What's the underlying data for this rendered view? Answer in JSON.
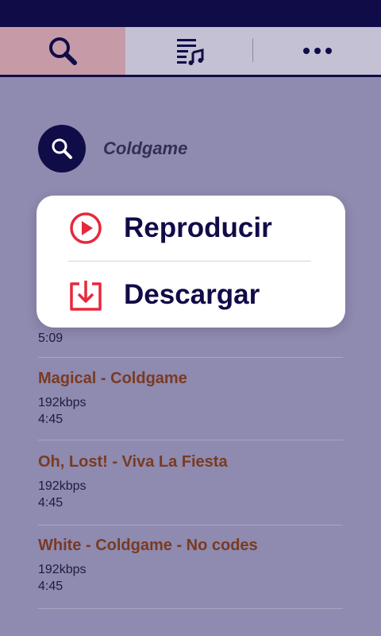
{
  "tabs": {
    "search": "search-icon",
    "playlist": "playlist-icon",
    "more": "more-icon"
  },
  "search": {
    "query": "Coldgame"
  },
  "results": [
    {
      "title": "",
      "bitrate": "",
      "duration": "5:09"
    },
    {
      "title": "Magical - Coldgame",
      "bitrate": "192kbps",
      "duration": "4:45"
    },
    {
      "title": "Oh, Lost! - Viva La Fiesta",
      "bitrate": "192kbps",
      "duration": "4:45"
    },
    {
      "title": "White - Coldgame - No codes",
      "bitrate": "192kbps",
      "duration": "4:45"
    }
  ],
  "menu": {
    "play_label": "Reproducir",
    "download_label": "Descargar"
  },
  "colors": {
    "brand": "#100c48",
    "accent_red": "#e8283c",
    "title_brown": "#7a3a22"
  }
}
